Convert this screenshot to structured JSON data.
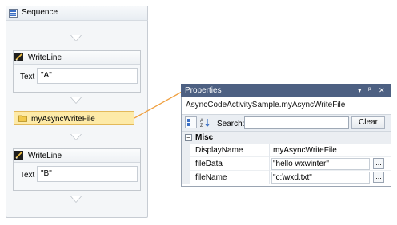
{
  "sequence": {
    "title": "Sequence",
    "activities": [
      {
        "type": "WriteLine",
        "title": "WriteLine",
        "field_label": "Text",
        "field_value": "\"A\""
      },
      {
        "type": "Async",
        "title": "myAsyncWriteFile"
      },
      {
        "type": "WriteLine",
        "title": "WriteLine",
        "field_label": "Text",
        "field_value": "\"B\""
      }
    ]
  },
  "properties": {
    "title": "Properties",
    "title_controls": [
      "▾",
      "ᵖ",
      "✕"
    ],
    "selected_type": "AsyncCodeActivitySample.myAsyncWriteFile",
    "search_label": "Search:",
    "search_value": "",
    "clear_label": "Clear",
    "category": {
      "toggle": "−",
      "name": "Misc"
    },
    "rows": [
      {
        "name": "DisplayName",
        "value": "myAsyncWriteFile",
        "has_ellipsis": false
      },
      {
        "name": "fileData",
        "value": "\"hello wxwinter\"",
        "has_ellipsis": true,
        "ellipsis": "..."
      },
      {
        "name": "fileName",
        "value": "\"c:\\wxd.txt\"",
        "has_ellipsis": true,
        "ellipsis": "..."
      }
    ]
  },
  "colors": {
    "selection_fill": "#fdeaa8",
    "selection_border": "#e3b95a",
    "connector": "#f0a040",
    "title_bar": "#4d6082"
  }
}
